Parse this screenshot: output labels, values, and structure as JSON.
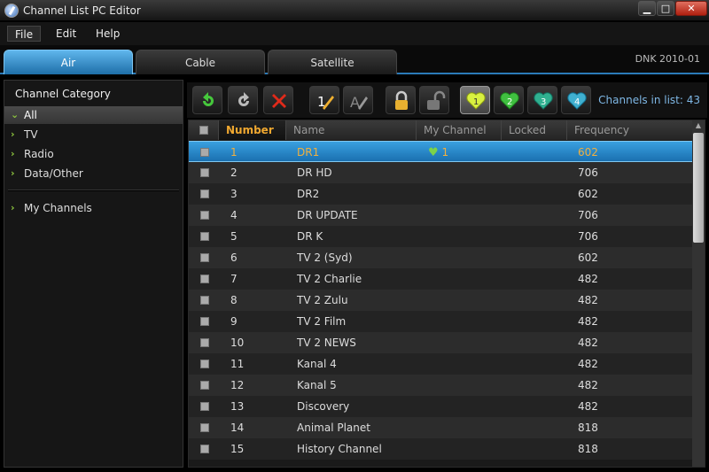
{
  "window": {
    "title": "Channel List PC Editor",
    "minimize": "▁",
    "maximize": "□",
    "close": "✕"
  },
  "menu": {
    "file": "File",
    "edit": "Edit",
    "help": "Help"
  },
  "tabs": {
    "air": "Air",
    "cable": "Cable",
    "satellite": "Satellite"
  },
  "build_info": "DNK  2010-01",
  "sidebar": {
    "header": "Channel Category",
    "items": [
      "All",
      "TV",
      "Radio",
      "Data/Other"
    ],
    "my_channels": "My Channels"
  },
  "toolbar": {
    "count_label": "Channels in list: 43",
    "heart_numbers": [
      "1",
      "2",
      "3",
      "4"
    ],
    "colors": {
      "green": "#46c83c",
      "red": "#e02a1a",
      "heart1": "#d8f040",
      "heart2": "#40c040",
      "heart3": "#30b090",
      "heart4": "#40b0d0"
    }
  },
  "table": {
    "headers": {
      "number": "Number",
      "name": "Name",
      "my_channel": "My Channel",
      "locked": "Locked",
      "frequency": "Frequency"
    },
    "rows": [
      {
        "number": "1",
        "name": "DR1",
        "my_channel": "1",
        "frequency": "602"
      },
      {
        "number": "2",
        "name": "DR HD",
        "my_channel": "",
        "frequency": "706"
      },
      {
        "number": "3",
        "name": "DR2",
        "my_channel": "",
        "frequency": "602"
      },
      {
        "number": "4",
        "name": "DR UPDATE",
        "my_channel": "",
        "frequency": "706"
      },
      {
        "number": "5",
        "name": "DR K",
        "my_channel": "",
        "frequency": "706"
      },
      {
        "number": "6",
        "name": "TV 2 (Syd)",
        "my_channel": "",
        "frequency": "602"
      },
      {
        "number": "7",
        "name": "TV 2 Charlie",
        "my_channel": "",
        "frequency": "482"
      },
      {
        "number": "8",
        "name": "TV 2 Zulu",
        "my_channel": "",
        "frequency": "482"
      },
      {
        "number": "9",
        "name": "TV 2 Film",
        "my_channel": "",
        "frequency": "482"
      },
      {
        "number": "10",
        "name": "TV 2 NEWS",
        "my_channel": "",
        "frequency": "482"
      },
      {
        "number": "11",
        "name": "Kanal 4",
        "my_channel": "",
        "frequency": "482"
      },
      {
        "number": "12",
        "name": "Kanal 5",
        "my_channel": "",
        "frequency": "482"
      },
      {
        "number": "13",
        "name": "Discovery",
        "my_channel": "",
        "frequency": "482"
      },
      {
        "number": "14",
        "name": "Animal Planet",
        "my_channel": "",
        "frequency": "818"
      },
      {
        "number": "15",
        "name": "History Channel",
        "my_channel": "",
        "frequency": "818"
      }
    ]
  }
}
